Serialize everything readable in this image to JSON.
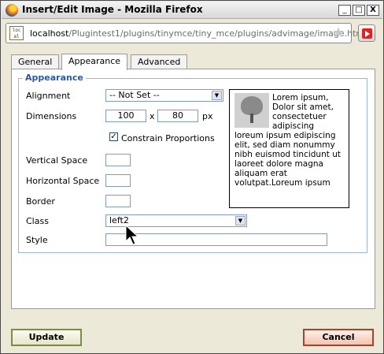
{
  "window": {
    "title": "Insert/Edit Image - Mozilla Firefox",
    "buttons": {
      "minimize": "_",
      "maximize": "□",
      "close": "X"
    }
  },
  "urlbar": {
    "host": "localhost",
    "path": "/Plugintest1/plugins/tinymce/tiny_mce/plugins/advimage/image.htm",
    "site_icon_text": "loc al"
  },
  "tabs": [
    {
      "label": "General",
      "active": false
    },
    {
      "label": "Appearance",
      "active": true
    },
    {
      "label": "Advanced",
      "active": false
    }
  ],
  "appearance": {
    "legend": "Appearance",
    "alignment": {
      "label": "Alignment",
      "value": "-- Not Set --"
    },
    "dimensions": {
      "label": "Dimensions",
      "width": "100",
      "x": "x",
      "height": "80",
      "unit": "px"
    },
    "constrain": {
      "label": "Constrain Proportions",
      "checked": true,
      "mark": "✓"
    },
    "vertical_space": {
      "label": "Vertical Space",
      "value": ""
    },
    "horizontal_space": {
      "label": "Horizontal Space",
      "value": ""
    },
    "border": {
      "label": "Border",
      "value": ""
    },
    "class": {
      "label": "Class",
      "value": "left2"
    },
    "style": {
      "label": "Style",
      "value": ""
    },
    "preview_text": "Lorem ipsum, Dolor sit amet, consectetuer adipiscing loreum ipsum edipiscing elit, sed diam nonummy nibh euismod tincidunt ut laoreet dolore magna aliquam erat volutpat.Loreum ipsum"
  },
  "footer": {
    "update_label": "Update",
    "cancel_label": "Cancel"
  },
  "colors": {
    "legend": "#2b5a9c",
    "update_border": "#7a8b4a",
    "cancel_border": "#a8432e"
  }
}
